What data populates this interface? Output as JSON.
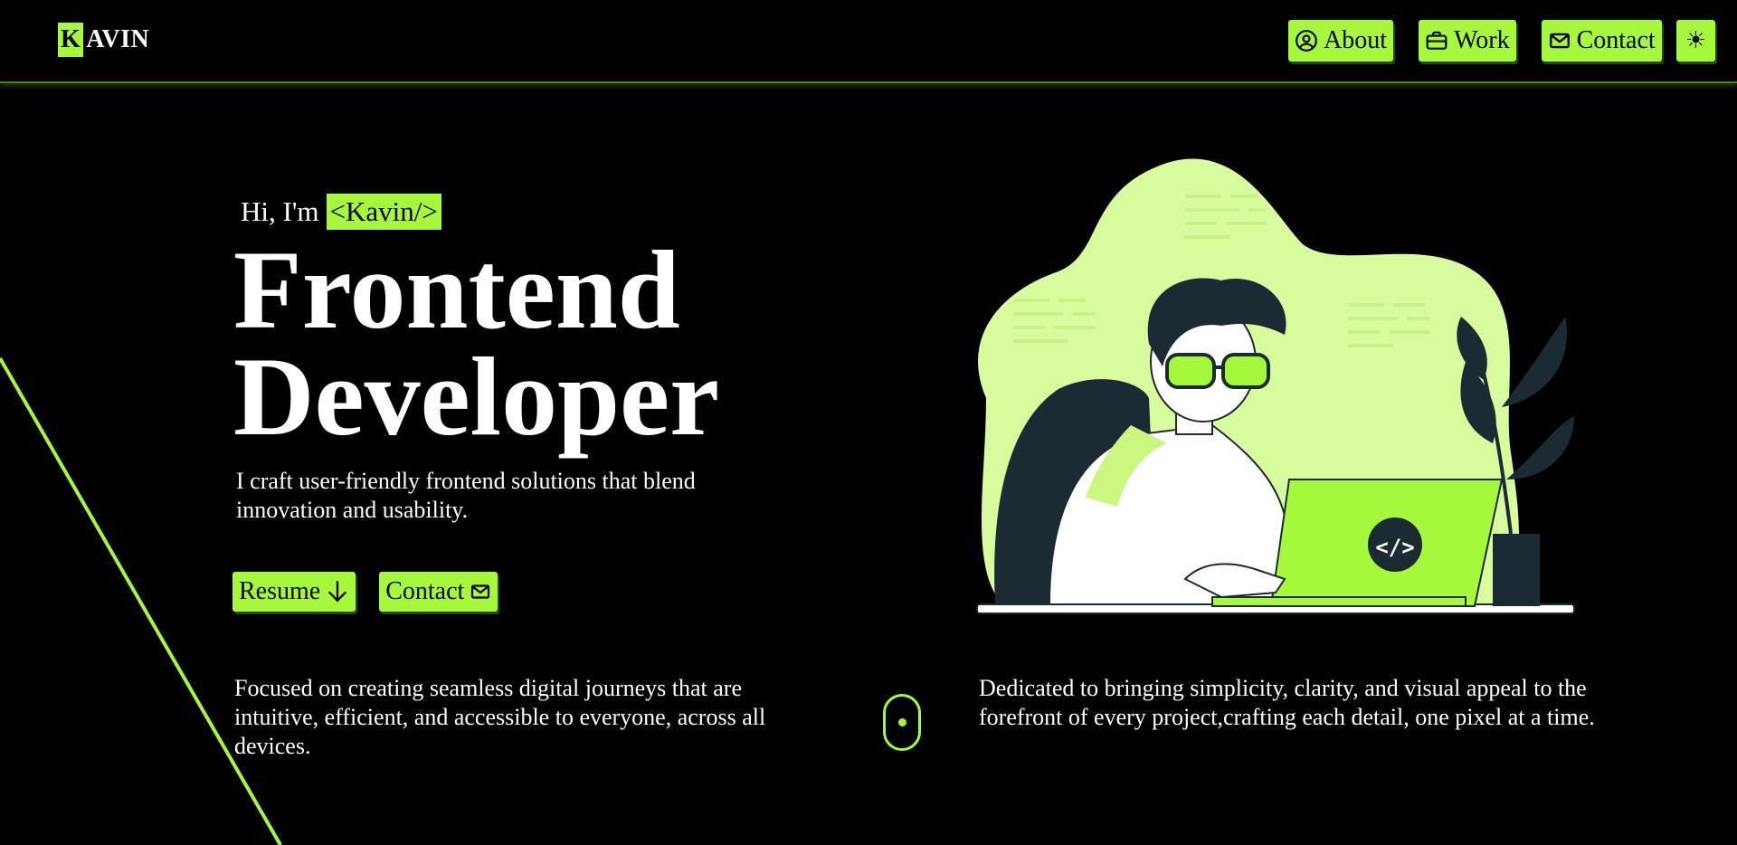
{
  "header": {
    "logo_initial": "K",
    "logo_rest": "AVIN",
    "nav": [
      {
        "label": "About",
        "icon": "user-circle-icon"
      },
      {
        "label": "Work",
        "icon": "briefcase-icon"
      },
      {
        "label": "Contact",
        "icon": "mail-icon"
      }
    ],
    "theme_toggle_icon": "sun-icon",
    "theme_toggle_glyph": "☀"
  },
  "hero": {
    "greeting": "Hi, I'm",
    "name_tag": "<Kavin/>",
    "title_line1": "Frontend",
    "title_line2": "Developer",
    "subtitle": "I craft user-friendly frontend solutions that blend innovation and usability.",
    "buttons": [
      {
        "label": "Resume",
        "icon": "arrow-down-icon"
      },
      {
        "label": "Contact",
        "icon": "mail-icon"
      }
    ]
  },
  "columns": {
    "left": "Focused on creating seamless digital journeys that are intuitive, efficient, and accessible to everyone, across all devices.",
    "right": "Dedicated to bringing simplicity, clarity, and visual appeal to the forefront of every project,crafting each detail, one pixel at a time."
  },
  "illustration": {
    "laptop_glyph": "</>"
  },
  "colors": {
    "accent": "#a6f83d",
    "background": "#000000",
    "text": "#ffffff",
    "dark_ink": "#1c2a33"
  }
}
